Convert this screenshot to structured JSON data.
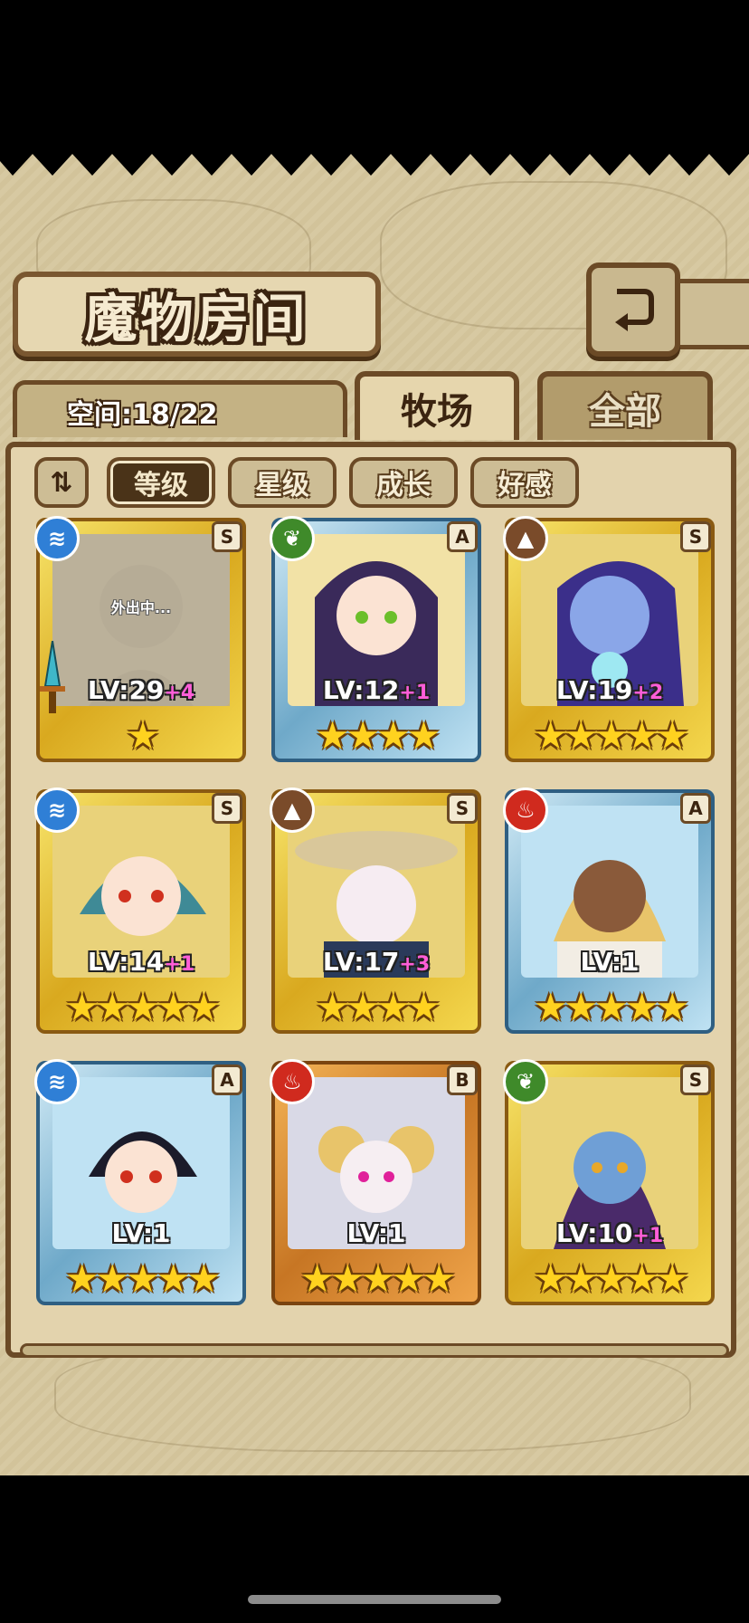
{
  "header": {
    "title": "魔物房间",
    "back_icon": "return-arrow-icon"
  },
  "tabs": {
    "space_label": "空间:18/22",
    "items": [
      {
        "label": "牧场",
        "active": true
      },
      {
        "label": "全部",
        "active": false
      }
    ]
  },
  "filters": {
    "sort_toggle_icon": "sort-order-icon",
    "items": [
      {
        "label": "等级",
        "active": true
      },
      {
        "label": "星级",
        "active": false
      },
      {
        "label": "成长",
        "active": false
      },
      {
        "label": "好感",
        "active": false
      }
    ]
  },
  "monsters": [
    {
      "element": "water",
      "rank": "S",
      "level": "LV:29",
      "bonus": "+4",
      "stars": "★",
      "status": "外出中...",
      "equipped_icon": "sword-icon"
    },
    {
      "element": "wind",
      "rank": "A",
      "level": "LV:12",
      "bonus": "+1",
      "stars": "★★★★"
    },
    {
      "element": "earth",
      "rank": "S",
      "level": "LV:19",
      "bonus": "+2",
      "stars": "★★★★★"
    },
    {
      "element": "water",
      "rank": "S",
      "level": "LV:14",
      "bonus": "+1",
      "stars": "★★★★★"
    },
    {
      "element": "earth",
      "rank": "S",
      "level": "LV:17",
      "bonus": "+3",
      "stars": "★★★★"
    },
    {
      "element": "fire",
      "rank": "A",
      "level": "LV:1",
      "bonus": "",
      "stars": "★★★★★"
    },
    {
      "element": "water",
      "rank": "A",
      "level": "LV:1",
      "bonus": "",
      "stars": "★★★★★"
    },
    {
      "element": "fire",
      "rank": "B",
      "level": "LV:1",
      "bonus": "",
      "stars": "★★★★★"
    },
    {
      "element": "wind",
      "rank": "S",
      "level": "LV:10",
      "bonus": "+1",
      "stars": "★★★★★"
    }
  ],
  "colors": {
    "panel": "#d7c9a2",
    "border": "#6b4a26",
    "water": "#2f7fd6",
    "wind": "#3f8a2a",
    "earth": "#7a4b2a",
    "fire": "#d02a1e",
    "level_bonus": "#ff5ed8",
    "star": "#ffd21f"
  }
}
